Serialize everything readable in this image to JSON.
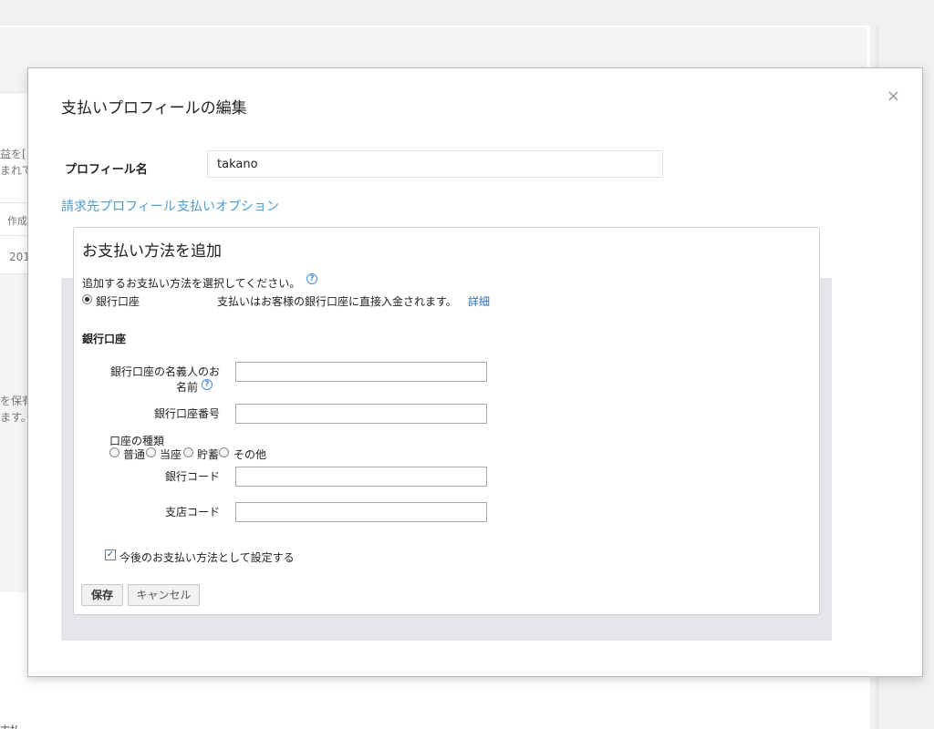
{
  "background": {
    "fragments": [
      "益を[",
      "まれて",
      "作成",
      "201",
      "を保有",
      "ます。",
      "支払"
    ]
  },
  "dialog": {
    "title": "支払いプロフィールの編集",
    "close_label": "×",
    "profile_name": {
      "label": "プロフィール名",
      "value": "takano"
    },
    "tabs": [
      "請求先プロフィール",
      "支払いオプション"
    ],
    "add_method": {
      "title": "お支払い方法を追加",
      "prompt": "追加するお支払い方法を選択してください。",
      "help_glyph": "?",
      "option": {
        "label": "銀行口座",
        "selected": true,
        "description": "支払いはお客様の銀行口座に直接入金されます。",
        "detail_link": "詳細"
      },
      "bank": {
        "section_title": "銀行口座",
        "holder_label_line1": "銀行口座の名義人のお",
        "holder_label_line2": "名前",
        "holder_value": "",
        "account_number_label": "銀行口座番号",
        "account_number_value": "",
        "account_type_label": "口座の種類",
        "account_types": [
          "普通",
          "当座",
          "貯蓄",
          "その他"
        ],
        "bank_code_label": "銀行コード",
        "bank_code_value": "",
        "branch_code_label": "支店コード",
        "branch_code_value": ""
      },
      "default_checkbox": {
        "label": "今後のお支払い方法として設定する",
        "checked": true,
        "check_glyph": "✓"
      },
      "buttons": {
        "save": "保存",
        "cancel": "キャンセル"
      }
    }
  }
}
